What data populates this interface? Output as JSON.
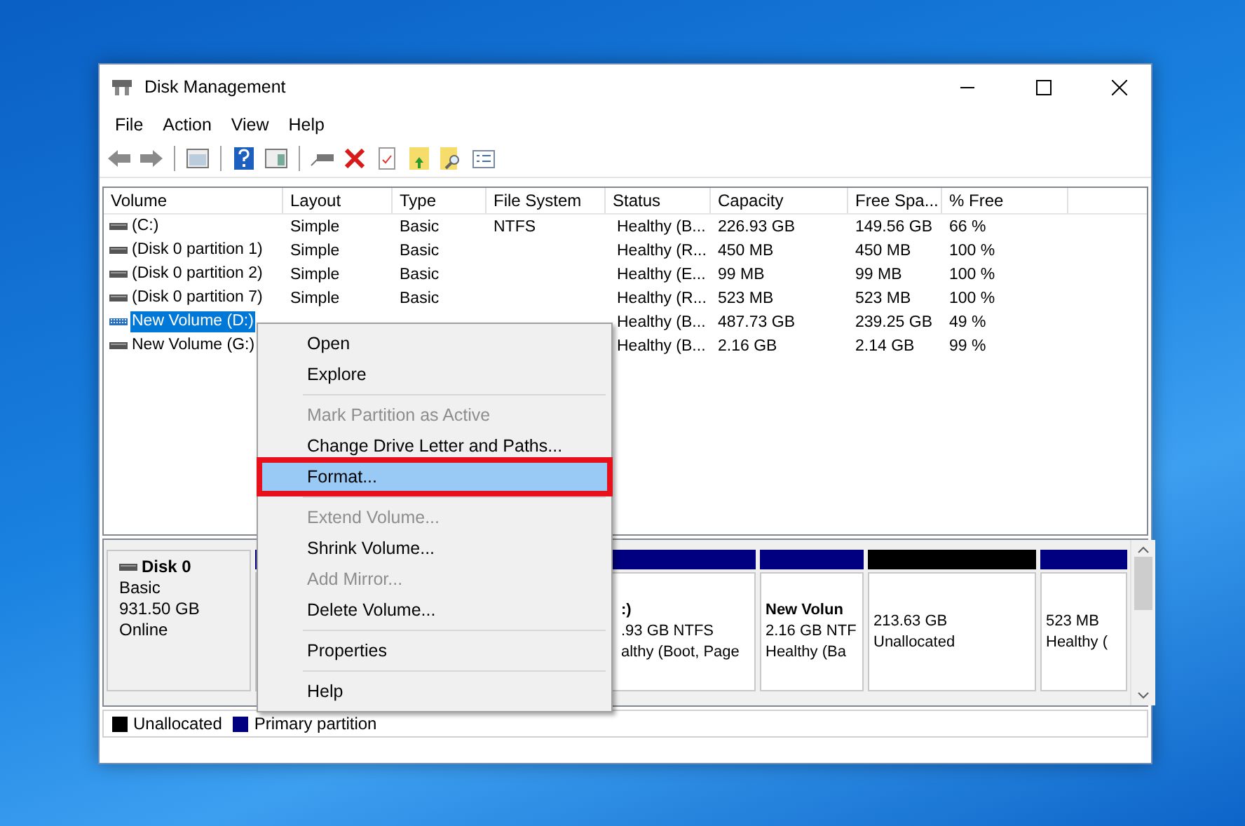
{
  "window": {
    "title": "Disk Management"
  },
  "menu_bar": [
    "File",
    "Action",
    "View",
    "Help"
  ],
  "table": {
    "columns": [
      "Volume",
      "Layout",
      "Type",
      "File System",
      "Status",
      "Capacity",
      "Free Spa...",
      "% Free"
    ],
    "rows": [
      {
        "selected": false,
        "cells": [
          "(C:)",
          "Simple",
          "Basic",
          "NTFS",
          "Healthy (B...",
          "226.93 GB",
          "149.56 GB",
          "66 %"
        ]
      },
      {
        "selected": false,
        "cells": [
          "(Disk 0 partition 1)",
          "Simple",
          "Basic",
          null,
          "Healthy (R...",
          "450 MB",
          "450 MB",
          "100 %"
        ]
      },
      {
        "selected": false,
        "cells": [
          "(Disk 0 partition 2)",
          "Simple",
          "Basic",
          null,
          "Healthy (E...",
          "99 MB",
          "99 MB",
          "100 %"
        ]
      },
      {
        "selected": false,
        "cells": [
          "(Disk 0 partition 7)",
          "Simple",
          "Basic",
          null,
          "Healthy (R...",
          "523 MB",
          "523 MB",
          "100 %"
        ]
      },
      {
        "selected": true,
        "cells": [
          "New Volume (D:)",
          null,
          null,
          null,
          "Healthy (B...",
          "487.73 GB",
          "239.25 GB",
          "49 %"
        ]
      },
      {
        "selected": false,
        "cells": [
          "New Volume (G:)",
          null,
          null,
          null,
          "Healthy (B...",
          "2.16 GB",
          "2.14 GB",
          "99 %"
        ]
      }
    ]
  },
  "disk": {
    "name": "Disk 0",
    "type": "Basic",
    "size": "931.50 GB",
    "status": "Online"
  },
  "partitions": [
    {
      "kind": "primary",
      "name": ":)",
      "lines": [
        ".93 GB NTFS",
        "althy (Boot, Page"
      ]
    },
    {
      "kind": "primary",
      "name": "New Volun",
      "lines": [
        "2.16 GB NTF",
        "Healthy (Ba"
      ]
    },
    {
      "kind": "unallocated",
      "lines": [
        "213.63 GB",
        "Unallocated"
      ]
    },
    {
      "kind": "primary",
      "lines": [
        "523 MB",
        "Healthy ("
      ]
    }
  ],
  "legend": [
    {
      "label": "Unallocated",
      "color": "#000000"
    },
    {
      "label": "Primary partition",
      "color": "#000080"
    }
  ],
  "context_menu": {
    "items": [
      {
        "kind": "item",
        "label": "Open",
        "disabled": false,
        "selected": false
      },
      {
        "kind": "item",
        "label": "Explore",
        "disabled": false,
        "selected": false
      },
      {
        "kind": "separator"
      },
      {
        "kind": "item",
        "label": "Mark Partition as Active",
        "disabled": true,
        "selected": false
      },
      {
        "kind": "item",
        "label": "Change Drive Letter and Paths...",
        "disabled": false,
        "selected": false
      },
      {
        "kind": "item",
        "label": "Format...",
        "disabled": false,
        "selected": true,
        "outlined": true
      },
      {
        "kind": "separator"
      },
      {
        "kind": "item",
        "label": "Extend Volume...",
        "disabled": true,
        "selected": false
      },
      {
        "kind": "item",
        "label": "Shrink Volume...",
        "disabled": false,
        "selected": false
      },
      {
        "kind": "item",
        "label": "Add Mirror...",
        "disabled": true,
        "selected": false
      },
      {
        "kind": "item",
        "label": "Delete Volume...",
        "disabled": false,
        "selected": false
      },
      {
        "kind": "separator"
      },
      {
        "kind": "item",
        "label": "Properties",
        "disabled": false,
        "selected": false
      },
      {
        "kind": "separator"
      },
      {
        "kind": "item",
        "label": "Help",
        "disabled": false,
        "selected": false
      }
    ]
  }
}
